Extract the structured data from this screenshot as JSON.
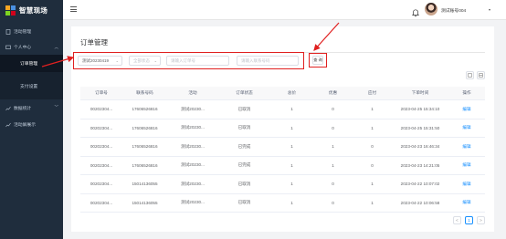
{
  "app": {
    "title": "智慧现场",
    "logo_colors": [
      "#f5a623",
      "#4a90e2",
      "#7ed321",
      "#d0021b"
    ]
  },
  "sidebar": {
    "items": [
      {
        "label": "活动管理",
        "icon": "document-icon"
      },
      {
        "label": "个人中心",
        "icon": "monitor-icon",
        "expanded": true,
        "children": [
          {
            "label": "订单管理",
            "active": true
          },
          {
            "label": "支付设置",
            "active": false
          }
        ]
      },
      {
        "label": "数据统计",
        "icon": "chart-icon",
        "expanded": false
      },
      {
        "label": "活动屏展示",
        "icon": "chart-icon"
      }
    ]
  },
  "header": {
    "menu_icon": "hamburger-icon",
    "notification_icon": "bell-icon",
    "username": "测试账号004"
  },
  "page": {
    "title": "订单管理"
  },
  "filters": {
    "activity_select": "测试20230419",
    "status_select_placeholder": "全部状态",
    "order_no_placeholder": "请输入订单号",
    "phone_placeholder": "请输入联系号码",
    "query_label": "查 询"
  },
  "tools": [
    "refresh-icon",
    "columns-icon"
  ],
  "table": {
    "headers": [
      "订单号",
      "联系号码",
      "活动",
      "订单状态",
      "总价",
      "优惠",
      "应付",
      "下单时间",
      "操作"
    ],
    "rows": [
      [
        "00202304...",
        "17606526816",
        "测试20230...",
        "已取消",
        "1",
        "0",
        "1",
        "2023-04-25 15:34:10",
        "编辑"
      ],
      [
        "00202304...",
        "17606526816",
        "测试20230...",
        "已取消",
        "1",
        "0",
        "1",
        "2023-04-25 15:31:50",
        "编辑"
      ],
      [
        "00202304...",
        "17606526816",
        "测试20230...",
        "已完成",
        "1",
        "1",
        "0",
        "2023-04-23 16:46:34",
        "编辑"
      ],
      [
        "00202304...",
        "17606526816",
        "测试20230...",
        "已完成",
        "1",
        "1",
        "0",
        "2023-04-23 14:21:05",
        "编辑"
      ],
      [
        "00202304...",
        "15014136055",
        "测试20230...",
        "已取消",
        "1",
        "0",
        "1",
        "2023-04-22 10:07:02",
        "编辑"
      ],
      [
        "00202304...",
        "15014136055",
        "测试20230...",
        "已取消",
        "1",
        "0",
        "1",
        "2023-04-22 10:06:58",
        "编辑"
      ]
    ]
  },
  "pagination": {
    "prev": "<",
    "current": "1",
    "next": ">"
  },
  "colors": {
    "sidebar_bg": "#1f2d3d",
    "accent": "#1890ff",
    "annotation": "#e02020"
  }
}
